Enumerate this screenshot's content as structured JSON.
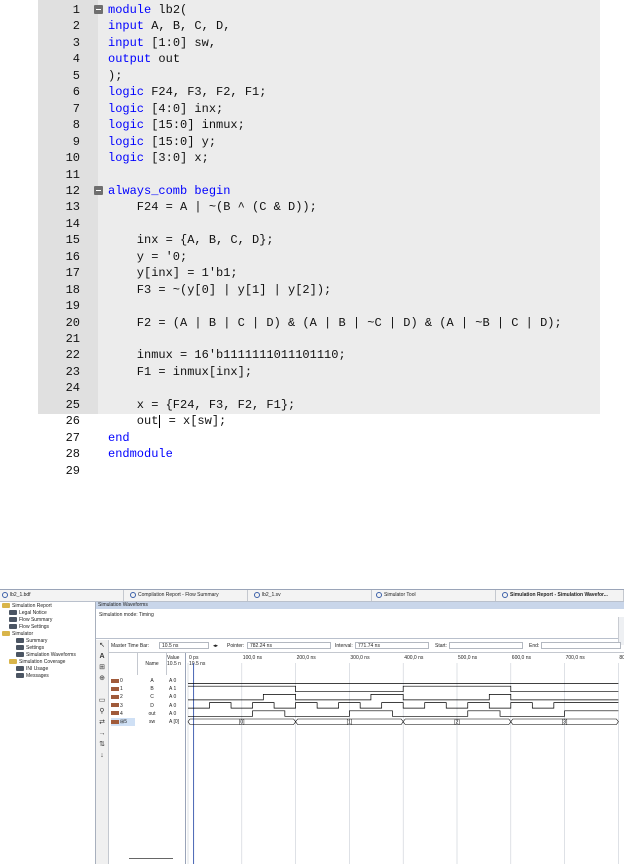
{
  "editor": {
    "lines": [
      {
        "n": "1",
        "fold": true,
        "tokens": [
          {
            "t": "module",
            "kw": true
          },
          {
            "t": " lb2(",
            "kw": false
          }
        ]
      },
      {
        "n": "2",
        "fold": false,
        "tokens": [
          {
            "t": "input",
            "kw": true
          },
          {
            "t": " A, B, C, D,",
            "kw": false
          }
        ]
      },
      {
        "n": "3",
        "fold": false,
        "tokens": [
          {
            "t": "input",
            "kw": true
          },
          {
            "t": " [1:0] sw,",
            "kw": false
          }
        ]
      },
      {
        "n": "4",
        "fold": false,
        "tokens": [
          {
            "t": "output",
            "kw": true
          },
          {
            "t": " out",
            "kw": false
          }
        ]
      },
      {
        "n": "5",
        "fold": false,
        "tokens": [
          {
            "t": ");",
            "kw": false
          }
        ]
      },
      {
        "n": "6",
        "fold": false,
        "tokens": [
          {
            "t": "logic",
            "kw": true
          },
          {
            "t": " F24, F3, F2, F1;",
            "kw": false
          }
        ]
      },
      {
        "n": "7",
        "fold": false,
        "tokens": [
          {
            "t": "logic",
            "kw": true
          },
          {
            "t": " [4:0] inx;",
            "kw": false
          }
        ]
      },
      {
        "n": "8",
        "fold": false,
        "tokens": [
          {
            "t": "logic",
            "kw": true
          },
          {
            "t": " [15:0] inmux;",
            "kw": false
          }
        ]
      },
      {
        "n": "9",
        "fold": false,
        "tokens": [
          {
            "t": "logic",
            "kw": true
          },
          {
            "t": " [15:0] y;",
            "kw": false
          }
        ]
      },
      {
        "n": "10",
        "fold": false,
        "tokens": [
          {
            "t": "logic",
            "kw": true
          },
          {
            "t": " [3:0] x;",
            "kw": false
          }
        ]
      },
      {
        "n": "11",
        "fold": false,
        "tokens": []
      },
      {
        "n": "12",
        "fold": true,
        "tokens": [
          {
            "t": "always_comb begin",
            "kw": true
          }
        ]
      },
      {
        "n": "13",
        "fold": false,
        "tokens": [
          {
            "t": "    F24 = A | ~(B ^ (C & D));",
            "kw": false
          }
        ]
      },
      {
        "n": "14",
        "fold": false,
        "tokens": []
      },
      {
        "n": "15",
        "fold": false,
        "tokens": [
          {
            "t": "    inx = {A, B, C, D};",
            "kw": false
          }
        ]
      },
      {
        "n": "16",
        "fold": false,
        "tokens": [
          {
            "t": "    y = '0;",
            "kw": false
          }
        ]
      },
      {
        "n": "17",
        "fold": false,
        "tokens": [
          {
            "t": "    y[inx] = 1'b1;",
            "kw": false
          }
        ]
      },
      {
        "n": "18",
        "fold": false,
        "tokens": [
          {
            "t": "    F3 = ~(y[0] | y[1] | y[2]);",
            "kw": false
          }
        ]
      },
      {
        "n": "19",
        "fold": false,
        "tokens": []
      },
      {
        "n": "20",
        "fold": false,
        "tokens": [
          {
            "t": "    F2 = (A | B | C | D) & (A | B | ~C | D) & (A | ~B | C | D);",
            "kw": false
          }
        ]
      },
      {
        "n": "21",
        "fold": false,
        "tokens": []
      },
      {
        "n": "22",
        "fold": false,
        "tokens": [
          {
            "t": "    inmux = 16'b1111111011101110;",
            "kw": false
          }
        ]
      },
      {
        "n": "23",
        "fold": false,
        "tokens": [
          {
            "t": "    F1 = inmux[inx];",
            "kw": false
          }
        ]
      },
      {
        "n": "24",
        "fold": false,
        "tokens": []
      },
      {
        "n": "25",
        "fold": false,
        "tokens": [
          {
            "t": "    x = {F24, F3, F2, F1};",
            "kw": false
          }
        ]
      },
      {
        "n": "26",
        "fold": false,
        "caret": true,
        "tokens": [
          {
            "t": "    out",
            "kw": false
          },
          {
            "t": " = x[sw];",
            "kw": false
          }
        ]
      },
      {
        "n": "27",
        "fold": false,
        "tokens": [
          {
            "t": "end",
            "kw": true
          }
        ]
      },
      {
        "n": "28",
        "fold": false,
        "tokens": [
          {
            "t": "endmodule",
            "kw": true
          }
        ]
      },
      {
        "n": "29",
        "fold": false,
        "tokens": []
      }
    ]
  },
  "simulator": {
    "tabs": [
      {
        "label": "lb2_1.bdf",
        "icon": "bdf-file-icon",
        "active": false
      },
      {
        "label": "Compilation Report - Flow Summary",
        "icon": "report-icon",
        "active": false
      },
      {
        "label": "lb2_1.sv",
        "icon": "sv-file-icon",
        "active": false
      },
      {
        "label": "Simulator Tool",
        "icon": "simulator-tool-icon",
        "active": false
      },
      {
        "label": "Simulation Report - Simulation Wavefor...",
        "icon": "report-icon",
        "active": true
      }
    ],
    "tree": [
      {
        "label": "Simulation Report",
        "level": 0,
        "icon": "folder"
      },
      {
        "label": "Legal Notice",
        "level": 1,
        "icon": "doc"
      },
      {
        "label": "Flow Summary",
        "level": 1,
        "icon": "table"
      },
      {
        "label": "Flow Settings",
        "level": 1,
        "icon": "table"
      },
      {
        "label": "Simulator",
        "level": 1,
        "icon": "folder"
      },
      {
        "label": "Summary",
        "level": 2,
        "icon": "table"
      },
      {
        "label": "Settings",
        "level": 2,
        "icon": "table"
      },
      {
        "label": "Simulation Waveforms",
        "level": 2,
        "icon": "wave"
      },
      {
        "label": "Simulation Coverage",
        "level": 2,
        "icon": "folder"
      },
      {
        "label": "INI Usage",
        "level": 2,
        "icon": "table"
      },
      {
        "label": "Messages",
        "level": 2,
        "icon": "msg"
      }
    ],
    "panel_title": "Simulation Waveforms",
    "sim_mode": "Simulation mode: Timing",
    "time_bar": {
      "master_label": "Master Time Bar:",
      "master_value": "10.5 ns",
      "pointer_label": "Pointer:",
      "pointer_value": "782.24 ns",
      "interval_label": "Interval:",
      "interval_value": "771.74 ns",
      "start_label": "Start:",
      "end_label": "End:"
    },
    "columns": {
      "name": "Name",
      "value": "Value\n10.5 n"
    },
    "time_marks": [
      "0 ps",
      "100,0 ns",
      "200,0 ns",
      "300,0 ns",
      "400,0 ns",
      "500,0 ns",
      "600,0 ns",
      "700,0 ns",
      "800.0 ns"
    ],
    "cursor_label": "10.5 ns",
    "signals": [
      {
        "idx": "0",
        "name": "A",
        "value": "A 0"
      },
      {
        "idx": "1",
        "name": "B",
        "value": "A 1"
      },
      {
        "idx": "2",
        "name": "C",
        "value": "A 0"
      },
      {
        "idx": "3",
        "name": "D",
        "value": "A 0"
      },
      {
        "idx": "4",
        "name": "out",
        "value": "A 0"
      },
      {
        "idx": "5",
        "name": "sw",
        "value": "A [0]",
        "bus": true
      }
    ],
    "bus_labels": [
      "[0]",
      "[1]",
      "[2]",
      "[3]"
    ]
  }
}
